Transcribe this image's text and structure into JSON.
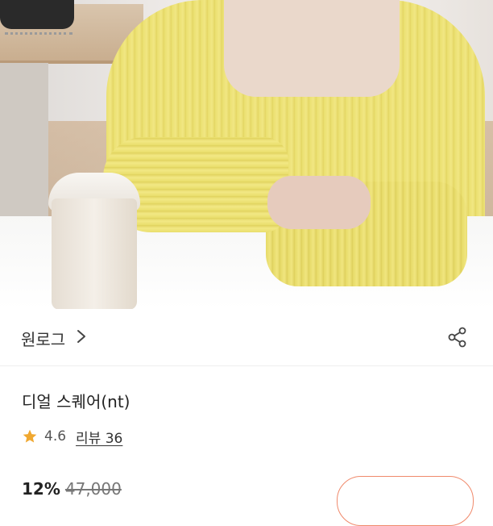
{
  "product_image": {
    "alt": "",
    "icon": "product-photo"
  },
  "brand": {
    "name": "원로그",
    "chevron_icon": "chevron-right-icon",
    "share_icon": "share-icon"
  },
  "product": {
    "title": "디얼 스퀘어(nt)"
  },
  "rating": {
    "star_icon": "star-icon",
    "score": "4.6",
    "review_label": "리뷰 36"
  },
  "price": {
    "discount": "12%",
    "original": "47,000"
  },
  "colors": {
    "star": "#F0A830",
    "button_border": "#F08A6C",
    "sweater": "#EFE47E"
  }
}
